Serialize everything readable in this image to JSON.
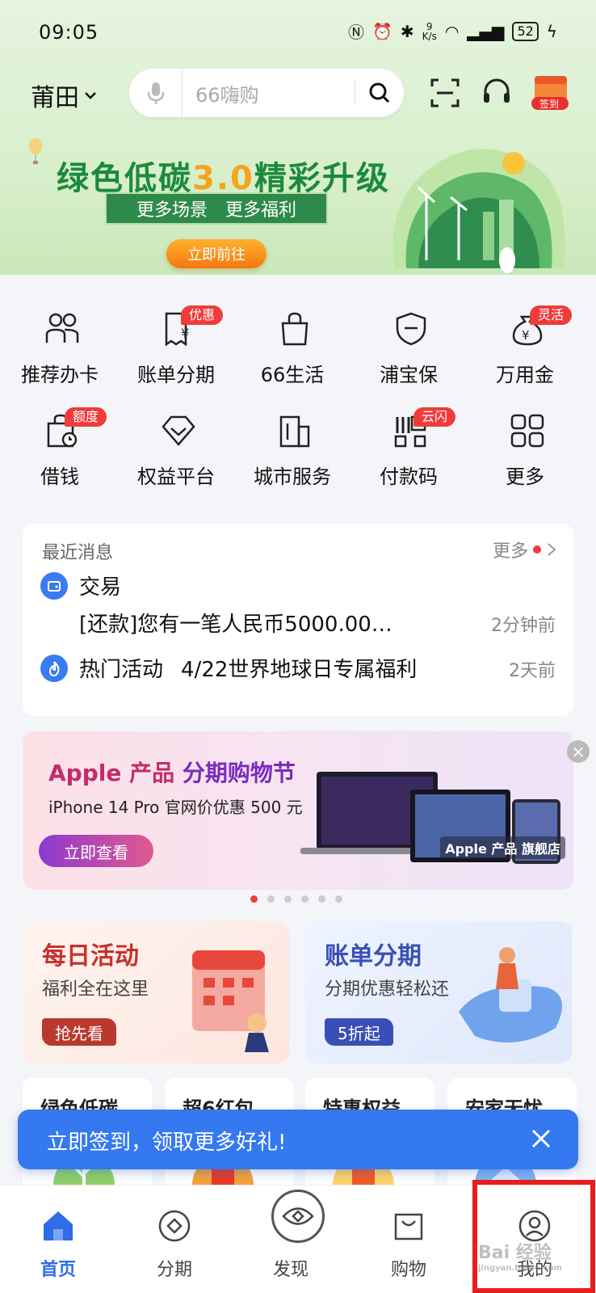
{
  "status": {
    "time": "09:05",
    "speed_num": "9",
    "speed_unit": "K/s",
    "battery": "52"
  },
  "header": {
    "city": "莆田",
    "search_placeholder": "66嗨购",
    "sign_label": "签到"
  },
  "banner": {
    "title_a": "绿色低碳",
    "title_hl": "3.0",
    "title_b": "精彩升级",
    "sub1": "更多场景",
    "sub2": "更多福利",
    "button": "立即前往"
  },
  "grid": [
    {
      "label": "推荐办卡",
      "icon": "people-icon"
    },
    {
      "label": "账单分期",
      "icon": "bill-icon",
      "badge": "优惠"
    },
    {
      "label": "66生活",
      "icon": "shopping-bag-icon"
    },
    {
      "label": "浦宝保",
      "icon": "shield-icon"
    },
    {
      "label": "万用金",
      "icon": "money-bag-icon",
      "badge": "灵活"
    },
    {
      "label": "借钱",
      "icon": "clock-bag-icon",
      "badge": "额度"
    },
    {
      "label": "权益平台",
      "icon": "diamond-icon"
    },
    {
      "label": "城市服务",
      "icon": "building-icon"
    },
    {
      "label": "付款码",
      "icon": "qrcode-icon",
      "badge": "云闪"
    },
    {
      "label": "更多",
      "icon": "apps-grid-icon"
    }
  ],
  "news": {
    "title": "最近消息",
    "more": "更多",
    "items": [
      {
        "category": "交易",
        "text": "[还款]您有一笔人民币5000.00…",
        "time": "2分钟前"
      },
      {
        "category": "热门活动",
        "text": "4/22世界地球日专属福利",
        "time": "2天前"
      }
    ]
  },
  "ad": {
    "title_a": "Apple 产品",
    "title_b": "分期购物节",
    "subtitle": "iPhone 14 Pro 官网价优惠 500 元",
    "button": "立即查看",
    "store": "Apple 产品 旗舰店"
  },
  "promos": [
    {
      "title": "每日活动",
      "subtitle": "福利全在这里",
      "button": "抢先看",
      "color": "#c8322c"
    },
    {
      "title": "账单分期",
      "subtitle": "分期优惠轻松还",
      "button": "5折起",
      "color": "#3a4fb5"
    }
  ],
  "minis": [
    "绿色低碳",
    "超6红包",
    "特惠权益",
    "安家无忧"
  ],
  "toast": {
    "text": "立即签到，领取更多好礼!"
  },
  "tabs": [
    {
      "label": "首页",
      "icon": "home-icon",
      "active": true
    },
    {
      "label": "分期",
      "icon": "installment-icon"
    },
    {
      "label": "发现",
      "icon": "discover-icon"
    },
    {
      "label": "购物",
      "icon": "cart-bag-icon"
    },
    {
      "label": "我的",
      "icon": "profile-icon"
    }
  ],
  "watermark": {
    "brand": "Bai 经验",
    "url": "jingyan.baidu.com"
  },
  "colors": {
    "brand_blue": "#3479f0",
    "green": "#1c8a3c",
    "badge_red": "#ef3b3b",
    "highlight_red": "#e81d1d"
  }
}
